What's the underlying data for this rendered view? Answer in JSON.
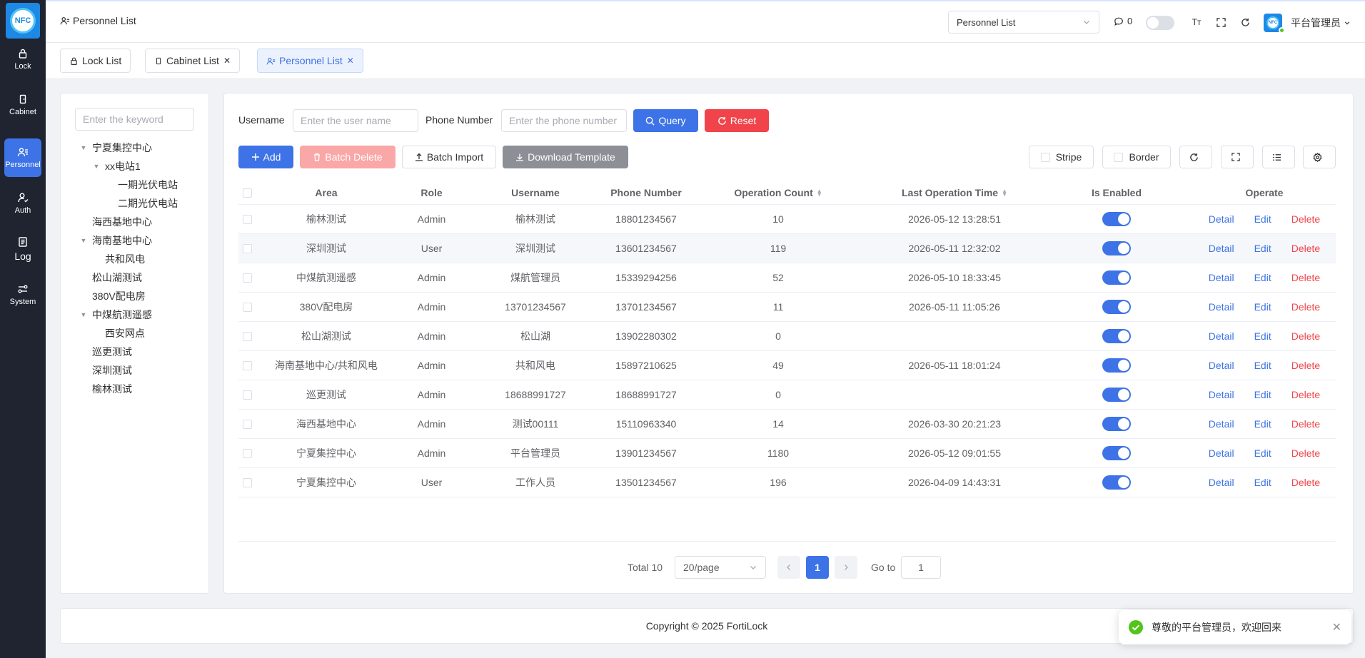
{
  "colors": {
    "primary": "#3d73e6",
    "danger": "#f0444a",
    "sidebar": "#1f2430",
    "success": "#52c41a"
  },
  "logo": {
    "text": "NFC"
  },
  "sidebar": {
    "items": [
      {
        "label": "Lock",
        "icon": "lock-icon"
      },
      {
        "label": "Cabinet",
        "icon": "cabinet-icon"
      },
      {
        "label": "Personnel",
        "icon": "personnel-icon",
        "active": true
      },
      {
        "label": "Auth",
        "icon": "auth-icon"
      },
      {
        "label": "Log",
        "icon": "log-icon"
      },
      {
        "label": "System",
        "icon": "system-icon"
      }
    ]
  },
  "header": {
    "breadcrumb": "Personnel List",
    "search_select": "Personnel List",
    "message_count": "0",
    "font_icon": "Tт",
    "avatar_text": "NFC",
    "user_name": "平台管理员"
  },
  "tabs": [
    {
      "label": "Lock List",
      "closable": false
    },
    {
      "label": "Cabinet List",
      "closable": true
    },
    {
      "label": "Personnel List",
      "closable": true,
      "active": true
    }
  ],
  "tree": {
    "placeholder": "Enter the keyword",
    "nodes": [
      {
        "label": "宁夏集控中心",
        "level": 0,
        "expanded": true
      },
      {
        "label": "xx电站1",
        "level": 1,
        "expanded": true
      },
      {
        "label": "一期光伏电站",
        "level": 2
      },
      {
        "label": "二期光伏电站",
        "level": 2
      },
      {
        "label": "海西基地中心",
        "level": 0
      },
      {
        "label": "海南基地中心",
        "level": 0,
        "expanded": true
      },
      {
        "label": "共和风电",
        "level": 1
      },
      {
        "label": "松山湖测试",
        "level": 0
      },
      {
        "label": "380V配电房",
        "level": 0
      },
      {
        "label": "中煤航测遥感",
        "level": 0,
        "expanded": true
      },
      {
        "label": "西安网点",
        "level": 1
      },
      {
        "label": "巡更测试",
        "level": 0
      },
      {
        "label": "深圳测试",
        "level": 0
      },
      {
        "label": "榆林测试",
        "level": 0
      }
    ]
  },
  "search": {
    "username_label": "Username",
    "username_placeholder": "Enter the user name",
    "phone_label": "Phone Number",
    "phone_placeholder": "Enter the phone number",
    "query_label": "Query",
    "reset_label": "Reset"
  },
  "toolbar": {
    "add_label": "Add",
    "batch_delete_label": "Batch Delete",
    "batch_import_label": "Batch Import",
    "download_template_label": "Download Template",
    "stripe_label": "Stripe",
    "border_label": "Border"
  },
  "table": {
    "columns": [
      "Area",
      "Role",
      "Username",
      "Phone Number",
      "Operation Count",
      "Last Operation Time",
      "Is Enabled",
      "Operate"
    ],
    "actions": {
      "detail": "Detail",
      "edit": "Edit",
      "delete": "Delete"
    },
    "rows": [
      {
        "area": "榆林测试",
        "role": "Admin",
        "username": "榆林测试",
        "phone": "18801234567",
        "count": "10",
        "time": "2026-05-12 13:28:51",
        "enabled": true
      },
      {
        "area": "深圳测试",
        "role": "User",
        "username": "深圳测试",
        "phone": "13601234567",
        "count": "119",
        "time": "2026-05-11 12:32:02",
        "enabled": true
      },
      {
        "area": "中煤航测遥感",
        "role": "Admin",
        "username": "煤航管理员",
        "phone": "15339294256",
        "count": "52",
        "time": "2026-05-10 18:33:45",
        "enabled": true
      },
      {
        "area": "380V配电房",
        "role": "Admin",
        "username": "13701234567",
        "phone": "13701234567",
        "count": "11",
        "time": "2026-05-11 11:05:26",
        "enabled": true
      },
      {
        "area": "松山湖测试",
        "role": "Admin",
        "username": "松山湖",
        "phone": "13902280302",
        "count": "0",
        "time": "",
        "enabled": true
      },
      {
        "area": "海南基地中心/共和风电",
        "role": "Admin",
        "username": "共和风电",
        "phone": "15897210625",
        "count": "49",
        "time": "2026-05-11 18:01:24",
        "enabled": true
      },
      {
        "area": "巡更测试",
        "role": "Admin",
        "username": "18688991727",
        "phone": "18688991727",
        "count": "0",
        "time": "",
        "enabled": true
      },
      {
        "area": "海西基地中心",
        "role": "Admin",
        "username": "测试00111",
        "phone": "15110963340",
        "count": "14",
        "time": "2026-03-30 20:21:23",
        "enabled": true
      },
      {
        "area": "宁夏集控中心",
        "role": "Admin",
        "username": "平台管理员",
        "phone": "13901234567",
        "count": "1180",
        "time": "2026-05-12 09:01:55",
        "enabled": true
      },
      {
        "area": "宁夏集控中心",
        "role": "User",
        "username": "工作人员",
        "phone": "13501234567",
        "count": "196",
        "time": "2026-04-09 14:43:31",
        "enabled": true
      }
    ]
  },
  "pagination": {
    "total_label": "Total 10",
    "page_size": "20/page",
    "current_page": "1",
    "goto_label": "Go to",
    "goto_value": "1"
  },
  "footer": {
    "copyright": "Copyright © 2025 FortiLock"
  },
  "toast": {
    "message": "尊敬的平台管理员，欢迎回来"
  }
}
